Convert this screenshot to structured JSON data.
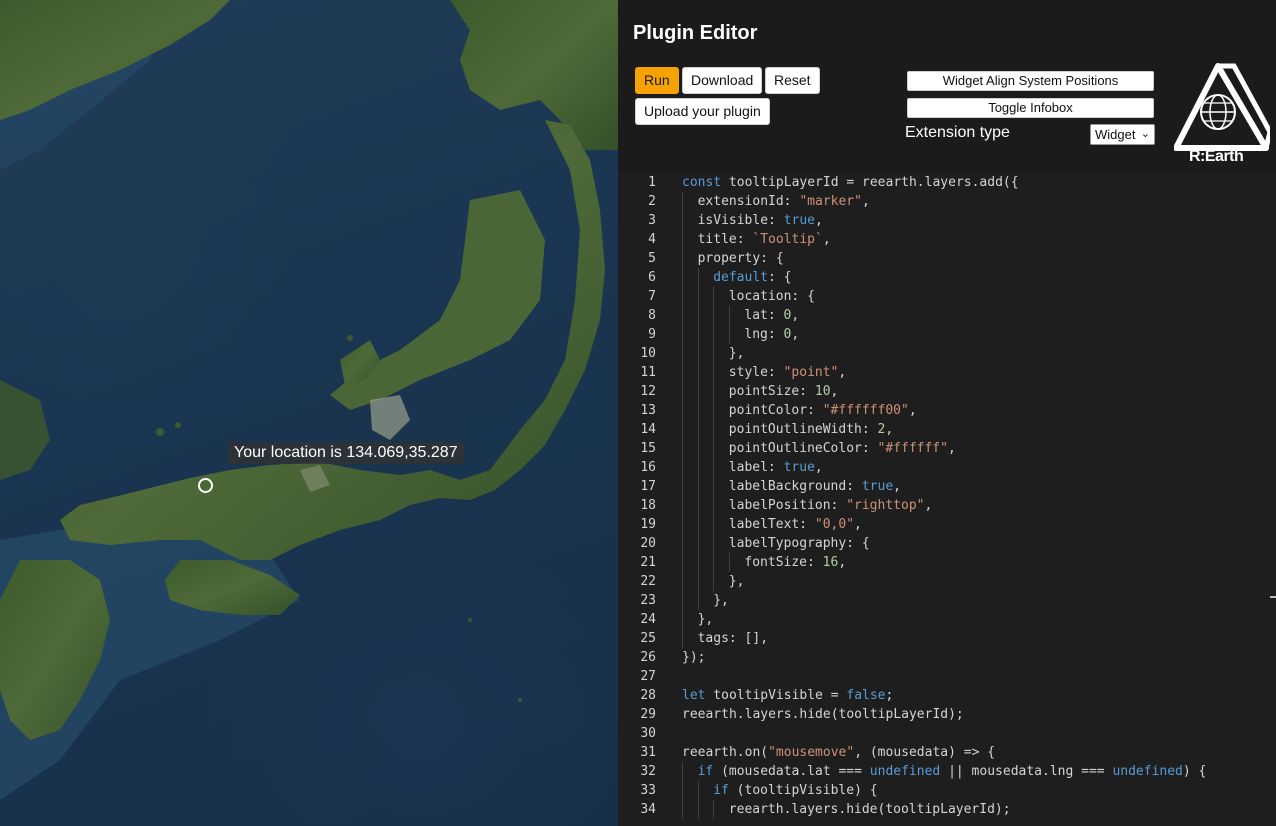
{
  "map": {
    "tooltip_text": "Your location is 134.069,35.287"
  },
  "editor": {
    "title": "Plugin Editor",
    "buttons": {
      "run": "Run",
      "download": "Download",
      "reset": "Reset",
      "upload": "Upload your plugin",
      "widget_align": "Widget Align System Positions",
      "toggle_infobox": "Toggle Infobox"
    },
    "extension_type_label": "Extension type",
    "extension_type_value": "Widget",
    "logo_text": "R:Earth"
  },
  "code_lines": [
    {
      "n": "1",
      "indent": 0,
      "tokens": [
        [
          "kw",
          "const"
        ],
        [
          "p",
          " tooltipLayerId = reearth.layers.add({"
        ]
      ]
    },
    {
      "n": "2",
      "indent": 1,
      "tokens": [
        [
          "p",
          "extensionId: "
        ],
        [
          "str",
          "\"marker\""
        ],
        [
          "p",
          ","
        ]
      ]
    },
    {
      "n": "3",
      "indent": 1,
      "tokens": [
        [
          "p",
          "isVisible: "
        ],
        [
          "kw",
          "true"
        ],
        [
          "p",
          ","
        ]
      ]
    },
    {
      "n": "4",
      "indent": 1,
      "tokens": [
        [
          "p",
          "title: "
        ],
        [
          "str",
          "`Tooltip`"
        ],
        [
          "p",
          ","
        ]
      ]
    },
    {
      "n": "5",
      "indent": 1,
      "tokens": [
        [
          "p",
          "property: {"
        ]
      ]
    },
    {
      "n": "6",
      "indent": 2,
      "tokens": [
        [
          "kw",
          "default"
        ],
        [
          "p",
          ": {"
        ]
      ]
    },
    {
      "n": "7",
      "indent": 3,
      "tokens": [
        [
          "p",
          "location: {"
        ]
      ]
    },
    {
      "n": "8",
      "indent": 4,
      "tokens": [
        [
          "p",
          "lat: "
        ],
        [
          "num",
          "0"
        ],
        [
          "p",
          ","
        ]
      ]
    },
    {
      "n": "9",
      "indent": 4,
      "tokens": [
        [
          "p",
          "lng: "
        ],
        [
          "num",
          "0"
        ],
        [
          "p",
          ","
        ]
      ]
    },
    {
      "n": "10",
      "indent": 3,
      "tokens": [
        [
          "p",
          "},"
        ]
      ]
    },
    {
      "n": "11",
      "indent": 3,
      "tokens": [
        [
          "p",
          "style: "
        ],
        [
          "str",
          "\"point\""
        ],
        [
          "p",
          ","
        ]
      ]
    },
    {
      "n": "12",
      "indent": 3,
      "tokens": [
        [
          "p",
          "pointSize: "
        ],
        [
          "num",
          "10"
        ],
        [
          "p",
          ","
        ]
      ]
    },
    {
      "n": "13",
      "indent": 3,
      "tokens": [
        [
          "p",
          "pointColor: "
        ],
        [
          "str",
          "\"#ffffff00\""
        ],
        [
          "p",
          ","
        ]
      ]
    },
    {
      "n": "14",
      "indent": 3,
      "tokens": [
        [
          "p",
          "pointOutlineWidth: "
        ],
        [
          "num",
          "2"
        ],
        [
          "p",
          ","
        ]
      ]
    },
    {
      "n": "15",
      "indent": 3,
      "tokens": [
        [
          "p",
          "pointOutlineColor: "
        ],
        [
          "str",
          "\"#ffffff\""
        ],
        [
          "p",
          ","
        ]
      ]
    },
    {
      "n": "16",
      "indent": 3,
      "tokens": [
        [
          "p",
          "label: "
        ],
        [
          "kw",
          "true"
        ],
        [
          "p",
          ","
        ]
      ]
    },
    {
      "n": "17",
      "indent": 3,
      "tokens": [
        [
          "p",
          "labelBackground: "
        ],
        [
          "kw",
          "true"
        ],
        [
          "p",
          ","
        ]
      ]
    },
    {
      "n": "18",
      "indent": 3,
      "tokens": [
        [
          "p",
          "labelPosition: "
        ],
        [
          "str",
          "\"righttop\""
        ],
        [
          "p",
          ","
        ]
      ]
    },
    {
      "n": "19",
      "indent": 3,
      "tokens": [
        [
          "p",
          "labelText: "
        ],
        [
          "str",
          "\"0,0\""
        ],
        [
          "p",
          ","
        ]
      ]
    },
    {
      "n": "20",
      "indent": 3,
      "tokens": [
        [
          "p",
          "labelTypography: {"
        ]
      ]
    },
    {
      "n": "21",
      "indent": 4,
      "tokens": [
        [
          "p",
          "fontSize: "
        ],
        [
          "num",
          "16"
        ],
        [
          "p",
          ","
        ]
      ]
    },
    {
      "n": "22",
      "indent": 3,
      "tokens": [
        [
          "p",
          "},"
        ]
      ]
    },
    {
      "n": "23",
      "indent": 2,
      "tokens": [
        [
          "p",
          "},"
        ]
      ]
    },
    {
      "n": "24",
      "indent": 1,
      "tokens": [
        [
          "p",
          "},"
        ]
      ]
    },
    {
      "n": "25",
      "indent": 1,
      "tokens": [
        [
          "p",
          "tags: [],"
        ]
      ]
    },
    {
      "n": "26",
      "indent": 0,
      "tokens": [
        [
          "p",
          "});"
        ]
      ]
    },
    {
      "n": "27",
      "indent": 0,
      "tokens": []
    },
    {
      "n": "28",
      "indent": 0,
      "tokens": [
        [
          "kw",
          "let"
        ],
        [
          "p",
          " tooltipVisible = "
        ],
        [
          "kw",
          "false"
        ],
        [
          "p",
          ";"
        ]
      ]
    },
    {
      "n": "29",
      "indent": 0,
      "tokens": [
        [
          "p",
          "reearth.layers.hide(tooltipLayerId);"
        ]
      ]
    },
    {
      "n": "30",
      "indent": 0,
      "tokens": []
    },
    {
      "n": "31",
      "indent": 0,
      "tokens": [
        [
          "p",
          "reearth.on("
        ],
        [
          "str",
          "\"mousemove\""
        ],
        [
          "p",
          ", (mousedata) => {"
        ]
      ]
    },
    {
      "n": "32",
      "indent": 1,
      "tokens": [
        [
          "kw",
          "if"
        ],
        [
          "p",
          " (mousedata.lat === "
        ],
        [
          "kw",
          "undefined"
        ],
        [
          "p",
          " || mousedata.lng === "
        ],
        [
          "kw",
          "undefined"
        ],
        [
          "p",
          ") {"
        ]
      ]
    },
    {
      "n": "33",
      "indent": 2,
      "tokens": [
        [
          "kw",
          "if"
        ],
        [
          "p",
          " (tooltipVisible) {"
        ]
      ]
    },
    {
      "n": "34",
      "indent": 3,
      "tokens": [
        [
          "p",
          "reearth.layers.hide(tooltipLayerId);"
        ]
      ]
    }
  ],
  "colors": {
    "accent_run": "#f5a202",
    "panel_bg": "#1b1b1b",
    "code_bg": "#1e1e1e",
    "keyword": "#569cd6",
    "string": "#ce9178",
    "number": "#b5cea8"
  }
}
